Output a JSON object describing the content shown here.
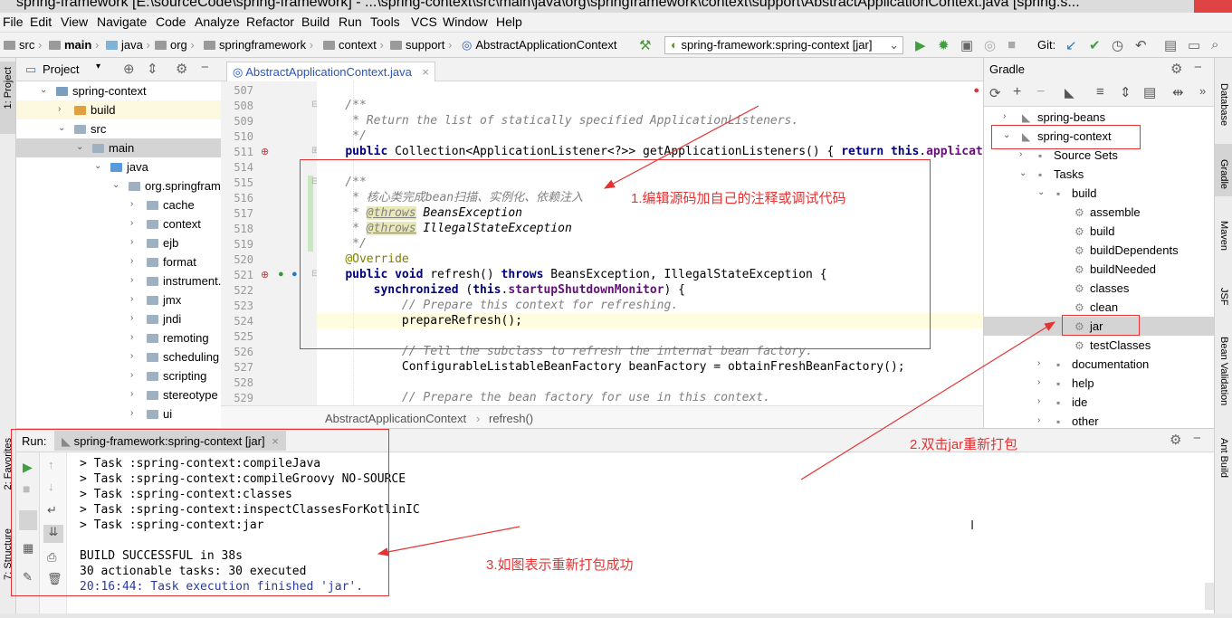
{
  "window": {
    "title": "spring-framework [E:\\sourceCode\\spring-framework] - ...\\spring-context\\src\\main\\java\\org\\springframework\\context\\support\\AbstractApplicationContext.java [spring.s..."
  },
  "menu": [
    "File",
    "Edit",
    "View",
    "Navigate",
    "Code",
    "Analyze",
    "Refactor",
    "Build",
    "Run",
    "Tools",
    "VCS",
    "Window",
    "Help"
  ],
  "breadcrumb": [
    "src",
    "main",
    "java",
    "org",
    "springframework",
    "context",
    "support",
    "AbstractApplicationContext"
  ],
  "run_config": "spring-framework:spring-context [jar]",
  "git_label": "Git:",
  "project_panel": {
    "title": "Project",
    "tree": [
      {
        "label": "spring-context",
        "depth": 1,
        "open": true,
        "icon": "module"
      },
      {
        "label": "build",
        "depth": 2,
        "open": false,
        "icon": "folder-orange"
      },
      {
        "label": "src",
        "depth": 2,
        "open": true,
        "icon": "folder"
      },
      {
        "label": "main",
        "depth": 3,
        "open": true,
        "icon": "folder"
      },
      {
        "label": "java",
        "depth": 4,
        "open": true,
        "icon": "folder-blue"
      },
      {
        "label": "org.springframework",
        "depth": 5,
        "open": true,
        "icon": "folder"
      },
      {
        "label": "cache",
        "depth": 6,
        "open": false,
        "icon": "folder"
      },
      {
        "label": "context",
        "depth": 6,
        "open": false,
        "icon": "folder"
      },
      {
        "label": "ejb",
        "depth": 6,
        "open": false,
        "icon": "folder"
      },
      {
        "label": "format",
        "depth": 6,
        "open": false,
        "icon": "folder"
      },
      {
        "label": "instrument.",
        "depth": 6,
        "open": false,
        "icon": "folder"
      },
      {
        "label": "jmx",
        "depth": 6,
        "open": false,
        "icon": "folder"
      },
      {
        "label": "jndi",
        "depth": 6,
        "open": false,
        "icon": "folder"
      },
      {
        "label": "remoting",
        "depth": 6,
        "open": false,
        "icon": "folder"
      },
      {
        "label": "scheduling",
        "depth": 6,
        "open": false,
        "icon": "folder"
      },
      {
        "label": "scripting",
        "depth": 6,
        "open": false,
        "icon": "folder"
      },
      {
        "label": "stereotype",
        "depth": 6,
        "open": false,
        "icon": "folder"
      },
      {
        "label": "ui",
        "depth": 6,
        "open": false,
        "icon": "folder"
      }
    ]
  },
  "editor": {
    "tab": "AbstractApplicationContext.java",
    "line_numbers": [
      "507",
      "508",
      "509",
      "510",
      "511",
      "514",
      "515",
      "516",
      "517",
      "518",
      "519",
      "520",
      "521",
      "522",
      "523",
      "524",
      "525",
      "526",
      "527",
      "528",
      "529"
    ],
    "breadcrumb": [
      "AbstractApplicationContext",
      "refresh()"
    ]
  },
  "gradle_panel": {
    "title": "Gradle",
    "tree": [
      {
        "label": "spring-beans",
        "x": 41,
        "arrow": "›",
        "icon": "elephant"
      },
      {
        "label": "spring-context",
        "x": 41,
        "arrow": "⌄",
        "icon": "elephant"
      },
      {
        "label": "Source Sets",
        "x": 59,
        "arrow": "›",
        "icon": "folder"
      },
      {
        "label": "Tasks",
        "x": 59,
        "arrow": "⌄",
        "icon": "folder"
      },
      {
        "label": "build",
        "x": 79,
        "arrow": "⌄",
        "icon": "folder"
      },
      {
        "label": "assemble",
        "x": 99,
        "arrow": "",
        "icon": "gear"
      },
      {
        "label": "build",
        "x": 99,
        "arrow": "",
        "icon": "gear"
      },
      {
        "label": "buildDependents",
        "x": 99,
        "arrow": "",
        "icon": "gear"
      },
      {
        "label": "buildNeeded",
        "x": 99,
        "arrow": "",
        "icon": "gear"
      },
      {
        "label": "classes",
        "x": 99,
        "arrow": "",
        "icon": "gear"
      },
      {
        "label": "clean",
        "x": 99,
        "arrow": "",
        "icon": "gear"
      },
      {
        "label": "jar",
        "x": 99,
        "arrow": "",
        "icon": "gear",
        "selected": true
      },
      {
        "label": "testClasses",
        "x": 99,
        "arrow": "",
        "icon": "gear"
      },
      {
        "label": "documentation",
        "x": 79,
        "arrow": "›",
        "icon": "folder"
      },
      {
        "label": "help",
        "x": 79,
        "arrow": "›",
        "icon": "folder"
      },
      {
        "label": "ide",
        "x": 79,
        "arrow": "›",
        "icon": "folder"
      },
      {
        "label": "other",
        "x": 79,
        "arrow": "›",
        "icon": "folder"
      }
    ]
  },
  "run_panel": {
    "label": "Run:",
    "tab": "spring-framework:spring-context [jar]",
    "output": [
      "> Task :spring-context:compileJava",
      "> Task :spring-context:compileGroovy NO-SOURCE",
      "> Task :spring-context:classes",
      "> Task :spring-context:inspectClassesForKotlinIC",
      "> Task :spring-context:jar",
      "",
      "BUILD SUCCESSFUL in 38s",
      "30 actionable tasks: 30 executed",
      "20:16:44: Task execution finished 'jar'."
    ]
  },
  "side_tabs": {
    "left": [
      "1: Project",
      "2: Favorites",
      "7: Structure"
    ],
    "right": [
      "Database",
      "Gradle",
      "Maven",
      "JSF",
      "Bean Validation",
      "Ant Build"
    ]
  },
  "annotations": {
    "a1": "1.编辑源码加自己的注释或调试代码",
    "a2": "2.双击jar重新打包",
    "a3": "3.如图表示重新打包成功"
  },
  "colors": {
    "annotation": "#e53333",
    "selection": "#d4d4d4",
    "link": "#2a56c0"
  }
}
